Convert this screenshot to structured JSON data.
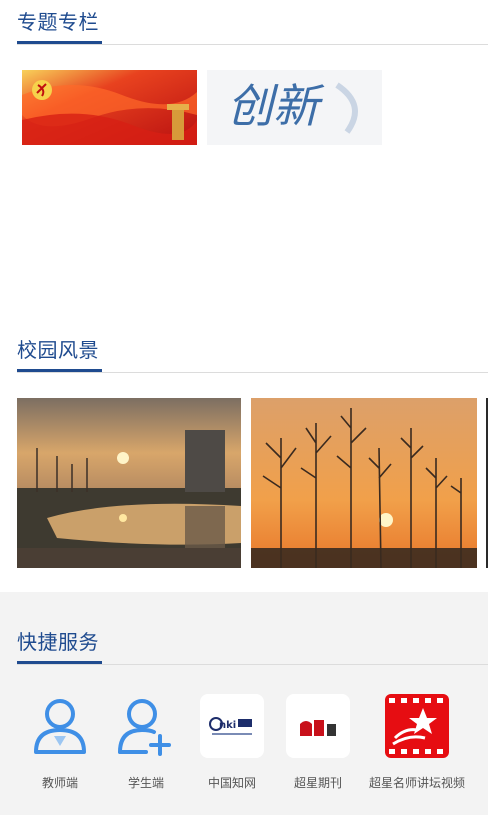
{
  "sections": {
    "topics": {
      "title": "专题专栏"
    },
    "campus": {
      "title": "校园风景"
    },
    "services": {
      "title": "快捷服务"
    }
  },
  "topics_banners": [
    {
      "name": "party-banner",
      "text": ""
    },
    {
      "name": "innovation-banner",
      "text": "创新"
    }
  ],
  "services": [
    {
      "label": "教师端",
      "icon": "teacher-user-icon"
    },
    {
      "label": "学生端",
      "icon": "student-add-user-icon"
    },
    {
      "label": "中国知网",
      "icon": "cnki-logo-icon"
    },
    {
      "label": "超星期刊",
      "icon": "chaoxing-journal-logo-icon"
    },
    {
      "label": "超星名师讲坛视频",
      "icon": "chaoxing-video-logo-icon"
    }
  ],
  "colors": {
    "accent": "#1f4b8f",
    "icon_blue": "#3f8fe6",
    "service_bg": "#f3f3f3"
  }
}
